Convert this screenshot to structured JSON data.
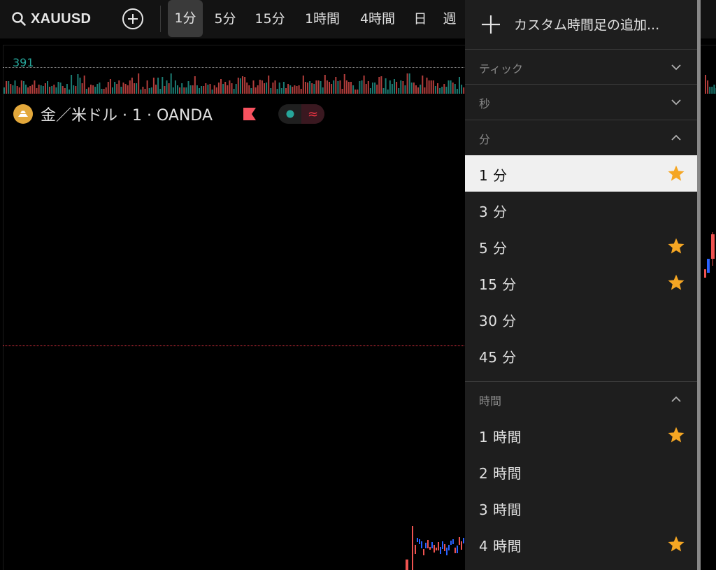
{
  "toolbar": {
    "symbol": "XAUUSD",
    "intervals": [
      {
        "label": "1分",
        "active": true
      },
      {
        "label": "5分",
        "active": false
      },
      {
        "label": "15分",
        "active": false
      },
      {
        "label": "1時間",
        "active": false
      },
      {
        "label": "4時間",
        "active": false
      },
      {
        "label": "日",
        "active": false
      },
      {
        "label": "週",
        "active": false
      }
    ]
  },
  "chart": {
    "volume_value": "391",
    "legend_title": "金／米ドル · 1 · OANDA",
    "colors": {
      "up": "#26a69a",
      "down": "#ef5350",
      "candle_up": "#2962ff",
      "star": "#f5a623",
      "flag": "#f7525f",
      "accent_line": "#f23645"
    }
  },
  "menu": {
    "custom_label": "カスタム時間足の追加...",
    "groups": [
      {
        "label": "ティック",
        "expanded": false
      },
      {
        "label": "秒",
        "expanded": false
      },
      {
        "label": "分",
        "expanded": true,
        "items": [
          {
            "label": "1 分",
            "favorite": true,
            "selected": true
          },
          {
            "label": "3 分",
            "favorite": false,
            "selected": false
          },
          {
            "label": "5 分",
            "favorite": true,
            "selected": false
          },
          {
            "label": "15 分",
            "favorite": true,
            "selected": false
          },
          {
            "label": "30 分",
            "favorite": false,
            "selected": false
          },
          {
            "label": "45 分",
            "favorite": false,
            "selected": false
          }
        ]
      },
      {
        "label": "時間",
        "expanded": true,
        "items": [
          {
            "label": "1 時間",
            "favorite": true,
            "selected": false
          },
          {
            "label": "2 時間",
            "favorite": false,
            "selected": false
          },
          {
            "label": "3 時間",
            "favorite": false,
            "selected": false
          },
          {
            "label": "4 時間",
            "favorite": true,
            "selected": false
          }
        ]
      }
    ]
  }
}
